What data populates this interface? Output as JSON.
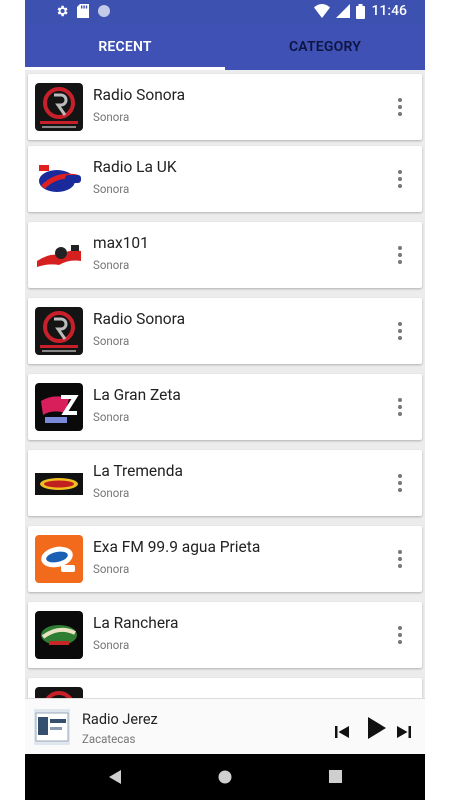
{
  "status_bar": {
    "time": "11:46",
    "icons": [
      "gear-icon",
      "sd-card-icon",
      "circle-notification-icon",
      "wifi-icon",
      "signal-icon",
      "battery-icon"
    ]
  },
  "tabs": [
    {
      "label": "RECENT",
      "selected": true
    },
    {
      "label": "CATEGORY",
      "selected": false
    }
  ],
  "stations": [
    {
      "name": "Radio Sonora",
      "city": "Sonora",
      "logo": "radio-sonora-logo"
    },
    {
      "name": "Radio La UK",
      "city": "Sonora",
      "logo": "radio-la-uk-logo"
    },
    {
      "name": "max101",
      "city": "Sonora",
      "logo": "max101-logo"
    },
    {
      "name": "Radio Sonora",
      "city": "Sonora",
      "logo": "radio-sonora-logo"
    },
    {
      "name": "La Gran Zeta",
      "city": "Sonora",
      "logo": "la-gran-zeta-logo"
    },
    {
      "name": "La Tremenda",
      "city": "Sonora",
      "logo": "la-tremenda-logo"
    },
    {
      "name": "Exa FM 99.9 agua Prieta",
      "city": "Sonora",
      "logo": "exa-fm-logo"
    },
    {
      "name": "La Ranchera",
      "city": "Sonora",
      "logo": "la-ranchera-logo"
    }
  ],
  "player": {
    "name": "Radio Jerez",
    "city": "Zacatecas",
    "controls": [
      "skip-previous-icon",
      "play-icon",
      "skip-next-icon"
    ]
  },
  "colors": {
    "app_bar": "#3f51b5",
    "status_bar": "#3d51b1",
    "background": "#ececec",
    "inactive_tab_text": "#0e1440"
  }
}
